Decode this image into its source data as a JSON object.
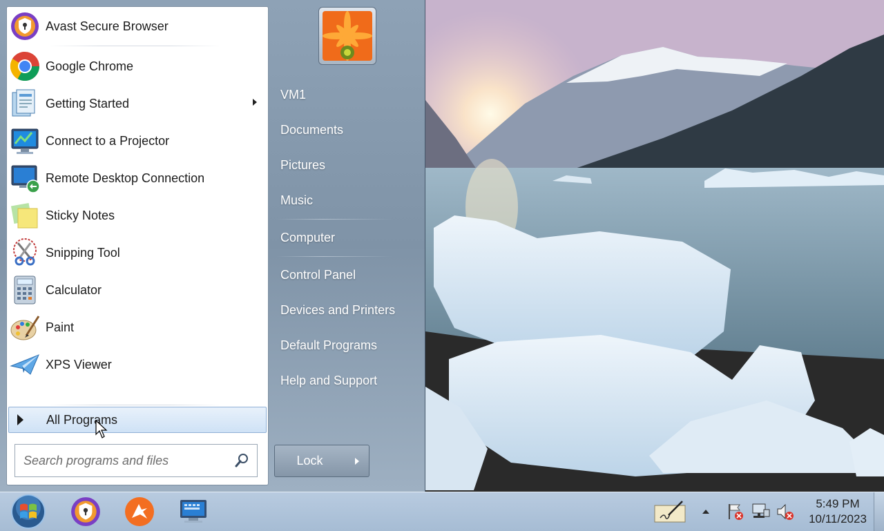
{
  "start_menu": {
    "programs": [
      {
        "label": "Avast Secure Browser",
        "icon": "avast-secure-browser-icon"
      },
      {
        "label": "Google Chrome",
        "icon": "chrome-icon"
      },
      {
        "label": "Getting Started",
        "icon": "getting-started-icon",
        "has_submenu": true
      },
      {
        "label": "Connect to a Projector",
        "icon": "projector-icon"
      },
      {
        "label": "Remote Desktop Connection",
        "icon": "remote-desktop-icon"
      },
      {
        "label": "Sticky Notes",
        "icon": "sticky-notes-icon"
      },
      {
        "label": "Snipping Tool",
        "icon": "snipping-tool-icon"
      },
      {
        "label": "Calculator",
        "icon": "calculator-icon"
      },
      {
        "label": "Paint",
        "icon": "paint-icon"
      },
      {
        "label": "XPS Viewer",
        "icon": "xps-viewer-icon"
      }
    ],
    "all_programs_label": "All Programs",
    "search_placeholder": "Search programs and files",
    "right_items": [
      "VM1",
      "Documents",
      "Pictures",
      "Music",
      "Computer",
      "Control Panel",
      "Devices and Printers",
      "Default Programs",
      "Help and Support"
    ],
    "lock_label": "Lock"
  },
  "taskbar": {
    "pinned": [
      "avast-secure-browser-icon",
      "avast-antivirus-icon",
      "remote-desktop-icon"
    ],
    "tray_icons": [
      "pen-input-icon",
      "show-hidden-icons-arrow",
      "action-center-flag-icon",
      "network-icon",
      "volume-muted-icon"
    ],
    "clock_time": "5:49 PM",
    "clock_date": "10/11/2023"
  },
  "colors": {
    "start_menu_right": "#8ea2b6",
    "taskbar": "#b0c4da",
    "all_programs_highlight": "#cfe2f6"
  }
}
